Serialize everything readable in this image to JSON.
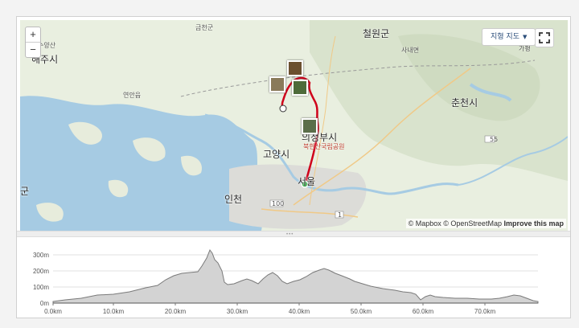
{
  "map": {
    "zoom_in": "+",
    "zoom_out": "−",
    "terrain_button": "지형 지도",
    "attribution": {
      "mapbox": "© Mapbox",
      "osm": "© OpenStreetMap",
      "improve": "Improve this map"
    },
    "labels": {
      "haeju": "해주시",
      "cheorwon": "철원군",
      "chuncheon": "춘천시",
      "uijeongbu": "의정부시",
      "goyang": "고양시",
      "seoul": "서울",
      "incheon": "인천",
      "yeonan": "연안읍",
      "geumcheon": "금천군",
      "sanae": "사내면",
      "gapyeong": "가평",
      "gun": "군",
      "suyang": "수양산",
      "bukhansan": "북한산국립공원"
    },
    "road_shields": [
      "55",
      "100",
      "1"
    ]
  },
  "elevation": {
    "y_ticks": [
      "300m",
      "200m",
      "100m",
      "0m"
    ],
    "x_ticks": [
      "0.0km",
      "10.0km",
      "20.0km",
      "30.0km",
      "40.0km",
      "50.0km",
      "60.0km",
      "70.0km"
    ]
  },
  "colors": {
    "route": "#d0021b",
    "water": "#a6cbe3",
    "start": "#27ae3e"
  }
}
